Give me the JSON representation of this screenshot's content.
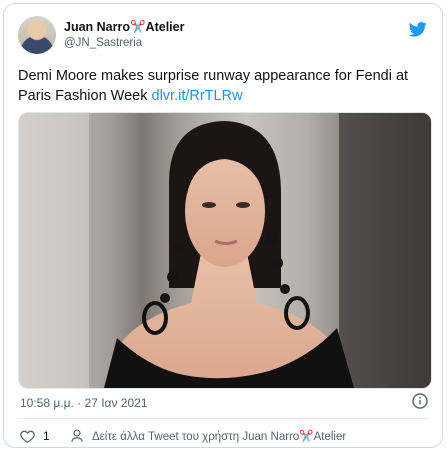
{
  "tweet": {
    "author": {
      "display_name": "Juan Narro✂️Atelier",
      "handle": "@JN_Sastreria"
    },
    "text": "Demi Moore makes surprise runway appearance for Fendi at Paris Fashion Week",
    "link": "dlvr.it/RrTLRw",
    "timestamp": "10:58 μ.μ. · 27 Ιαν 2021",
    "likes": "1",
    "more_tweets_label": "Δείτε άλλα Tweet του χρήστη Juan Narro✂️Atelier"
  },
  "colors": {
    "accent": "#1d9bf0",
    "link": "#1b95e0",
    "like": "#e0245e"
  }
}
